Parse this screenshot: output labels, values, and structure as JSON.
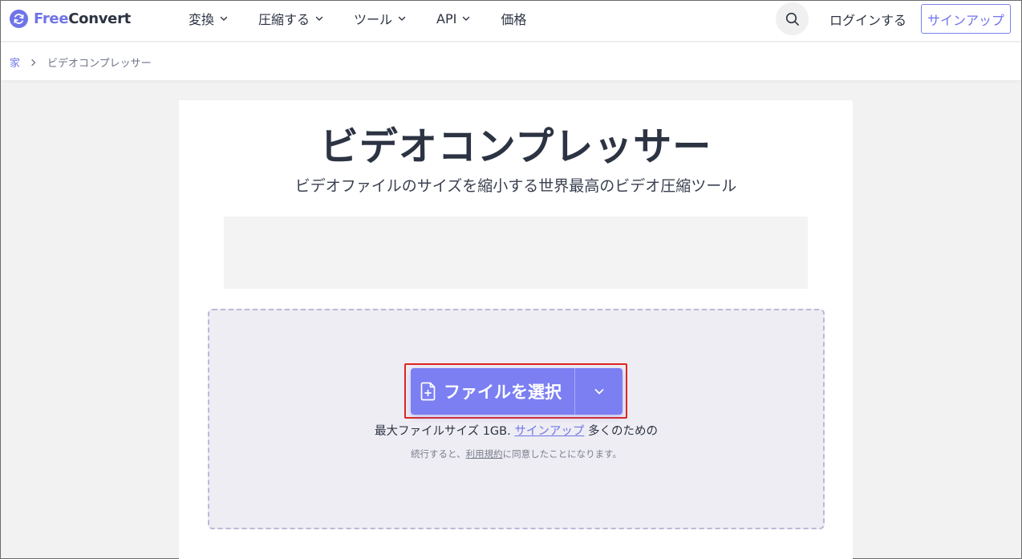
{
  "brand": {
    "logo_free": "Free",
    "logo_convert": "Convert",
    "accent_color": "#6f74e8"
  },
  "nav": {
    "items": [
      {
        "label": "変換",
        "has_dropdown": true
      },
      {
        "label": "圧縮する",
        "has_dropdown": true
      },
      {
        "label": "ツール",
        "has_dropdown": true
      },
      {
        "label": "API",
        "has_dropdown": true
      },
      {
        "label": "価格",
        "has_dropdown": false
      }
    ],
    "search_icon": "search-icon",
    "login_label": "ログインする",
    "signup_label": "サインアップ"
  },
  "breadcrumb": {
    "home": "家",
    "current": "ビデオコンプレッサー"
  },
  "main": {
    "title": "ビデオコンプレッサー",
    "subtitle": "ビデオファイルのサイズを縮小する世界最高のビデオ圧縮ツール",
    "choose_button_label": "ファイルを選択",
    "choose_button_color": "#7b7ff2",
    "limit_prefix": "最大ファイルサイズ 1GB.",
    "limit_link": "サインアップ",
    "limit_suffix": "多くのための",
    "terms_prefix": "続行すると、",
    "terms_link": "利用規約",
    "terms_suffix": "に同意したことになります。"
  }
}
